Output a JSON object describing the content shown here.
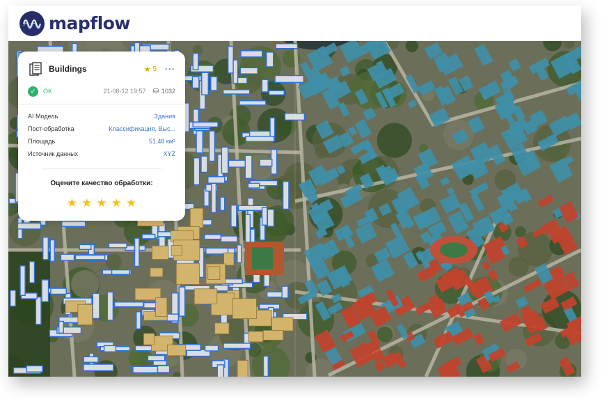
{
  "app": {
    "name": "mapflow",
    "logo_icon": "wave-logo-icon",
    "accent": "#2a2f6e"
  },
  "card": {
    "icon": "document-stack-icon",
    "title": "Buildings",
    "rating": "5",
    "rating_icon": "star-icon",
    "more": "···",
    "status": "OK",
    "status_color": "#2fb36b",
    "timestamp": "21-08-12 19:57",
    "count": "1032",
    "count_icon": "coins-icon",
    "rows": [
      {
        "key": "AI Модель",
        "value": "Здания"
      },
      {
        "key": "Пост-обработка",
        "value": "Классификация, Выс..."
      },
      {
        "key": "Площадь",
        "value": "51.48 км²"
      },
      {
        "key": "Источник данных",
        "value": "XYZ"
      }
    ],
    "rate_prompt": "Оцените качество обработки:",
    "stars": 5
  },
  "map": {
    "left_mode": "satellite-with-building-outlines",
    "right_mode": "3d-classified-buildings",
    "building_color_residential": "#3f8fa8",
    "building_color_other": "#c0432e"
  }
}
